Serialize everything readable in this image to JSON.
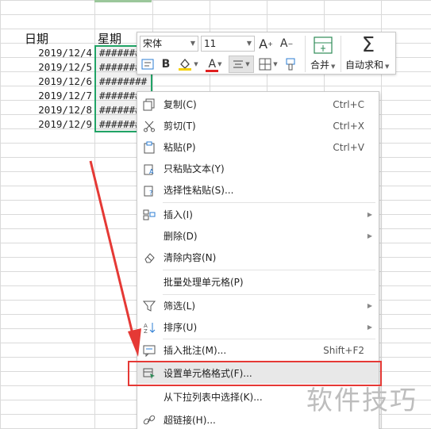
{
  "sheet": {
    "headers": {
      "date": "日期",
      "weekday": "星期"
    },
    "dates": [
      "2019/12/4",
      "2019/12/5",
      "2019/12/6",
      "2019/12/7",
      "2019/12/8",
      "2019/12/9"
    ],
    "hash_cells": [
      "########",
      "########",
      "########",
      "########",
      "########",
      "########"
    ]
  },
  "mini_toolbar": {
    "font_name": "宋体",
    "font_size": "11",
    "grow_font": "A",
    "shrink_font": "A",
    "bold": "B",
    "font_color": "A",
    "merge_label": "合并",
    "autosum_label": "自动求和"
  },
  "context_menu": {
    "items": [
      {
        "label": "复制(C)",
        "shortcut": "Ctrl+C",
        "icon": "copy-icon"
      },
      {
        "label": "剪切(T)",
        "shortcut": "Ctrl+X",
        "icon": "scissors-icon"
      },
      {
        "label": "粘贴(P)",
        "shortcut": "Ctrl+V",
        "icon": "paste-icon"
      },
      {
        "label": "只粘贴文本(Y)",
        "shortcut": "",
        "icon": "paste-text-icon"
      },
      {
        "label": "选择性粘贴(S)...",
        "shortcut": "",
        "icon": "paste-special-icon"
      },
      {
        "label": "插入(I)",
        "shortcut": "",
        "icon": "insert-icon"
      },
      {
        "label": "删除(D)",
        "shortcut": "",
        "icon": ""
      },
      {
        "label": "清除内容(N)",
        "shortcut": "",
        "icon": "eraser-icon"
      },
      {
        "label": "批量处理单元格(P)",
        "shortcut": "",
        "icon": ""
      },
      {
        "label": "筛选(L)",
        "shortcut": "",
        "icon": "filter-icon"
      },
      {
        "label": "排序(U)",
        "shortcut": "",
        "icon": "sort-icon"
      },
      {
        "label": "插入批注(M)...",
        "shortcut": "Shift+F2",
        "icon": "comment-icon"
      },
      {
        "label": "设置单元格格式(F)...",
        "shortcut": "",
        "icon": "format-cells-icon"
      },
      {
        "label": "从下拉列表中选择(K)...",
        "shortcut": "",
        "icon": ""
      },
      {
        "label": "超链接(H)...",
        "shortcut": "",
        "icon": "link-icon"
      }
    ]
  },
  "watermark": "软件技巧",
  "colors": {
    "selection": "#21a366",
    "highlight_box": "#e53935",
    "arrow": "#e53935"
  }
}
